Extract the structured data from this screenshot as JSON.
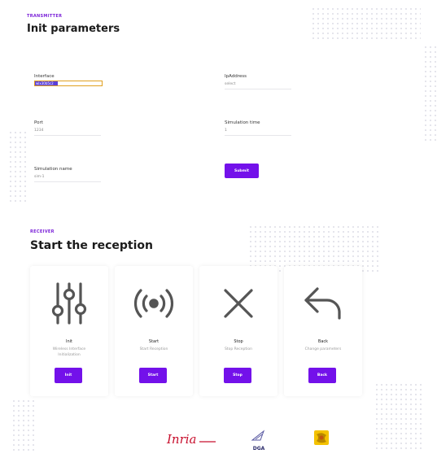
{
  "transmitter": {
    "section_label": "TRANSMITTER",
    "title": "Init parameters",
    "fields": {
      "interface": {
        "label": "Interface",
        "value": "wlx30b5c2"
      },
      "ip_address": {
        "label": "IpAddress",
        "value": "select"
      },
      "port": {
        "label": "Port",
        "value": "1234"
      },
      "simulation_time": {
        "label": "Simulation time",
        "value": "1"
      },
      "simulation_name": {
        "label": "Simulation name",
        "value": "sim-1"
      }
    },
    "submit_label": "Submit"
  },
  "receiver": {
    "section_label": "RECEIVER",
    "title": "Start the reception",
    "cards": [
      {
        "icon": "sliders-icon",
        "title": "Init",
        "desc_line1": "Wireless Interface",
        "desc_line2": "Initialization",
        "button": "Init"
      },
      {
        "icon": "broadcast-icon",
        "title": "Start",
        "desc_line1": "Start Reception",
        "desc_line2": "",
        "button": "Start"
      },
      {
        "icon": "close-x-icon",
        "title": "Stop",
        "desc_line1": "Stop Reception",
        "desc_line2": "",
        "button": "Stop"
      },
      {
        "icon": "back-arrow-icon",
        "title": "Back",
        "desc_line1": "Change parameters",
        "desc_line2": "",
        "button": "Back"
      }
    ]
  },
  "footer": {
    "logos": {
      "inria": "Inria",
      "dga": "DGA"
    }
  },
  "colors": {
    "accent": "#7311ea",
    "section_label": "#7b22d8",
    "inria_red": "#c8102e",
    "focus_border": "#e0a020"
  }
}
